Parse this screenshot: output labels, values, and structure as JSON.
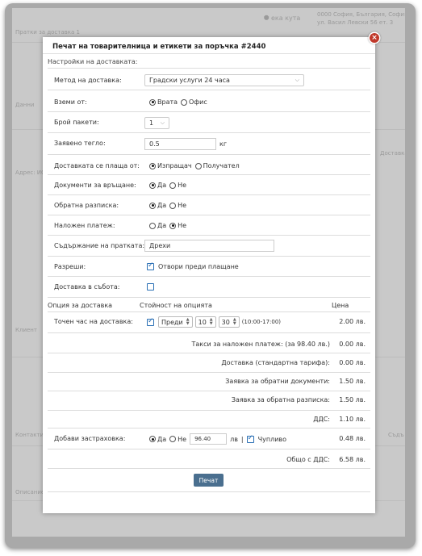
{
  "background": {
    "hint_top": "Пратки за доставка 1",
    "store": "⯃ ека кута",
    "addr1": "0000 София, България, София",
    "addr2": "ул. Васил Левски 56 ет. 3",
    "side1": "Данни",
    "side2": "Адрес: ИО",
    "side3": "Клиент",
    "side4": "Контакти",
    "side5": "Описание",
    "right1": "Доставка",
    "right2": "Съдъ"
  },
  "modal": {
    "title": "Печат на товарителница и етикети за поръчка #2440",
    "close": "×",
    "section": "Настройки на доставката:"
  },
  "fields": {
    "method": {
      "label": "Метод на доставка:",
      "value": "Градски услуги 24 часа"
    },
    "pickup": {
      "label": "Вземи от:",
      "opt1": "Врата",
      "opt2": "Офис"
    },
    "packages": {
      "label": "Брой пакети:",
      "value": "1"
    },
    "weight": {
      "label": "Заявено тегло:",
      "value": "0.5",
      "unit": "кг"
    },
    "payer": {
      "label": "Доставката се плаща от:",
      "opt1": "Изпращач",
      "opt2": "Получател"
    },
    "return_docs": {
      "label": "Документи за връщане:",
      "opt1": "Да",
      "opt2": "Не"
    },
    "return_receipt": {
      "label": "Обратна разписка:",
      "opt1": "Да",
      "opt2": "Не"
    },
    "cod": {
      "label": "Наложен платеж:",
      "opt1": "Да",
      "opt2": "Не"
    },
    "contents": {
      "label": "Съдържание на пратката:",
      "value": "Дрехи"
    },
    "allow": {
      "label": "Разреши:",
      "option": "Отвори преди плащане"
    },
    "saturday": {
      "label": "Доставка в събота:"
    }
  },
  "table": {
    "h_option": "Опция за доставка",
    "h_value": "Стойност на опцията",
    "h_price": "Цена",
    "exact_time": {
      "label": "Точен час на доставка:",
      "mode": "Преди",
      "hour": "10",
      "minute": "30",
      "range": "(10:00-17:00)",
      "price": "2.00 лв."
    },
    "fees": [
      {
        "label": "Такси за наложен платеж: (за 98.40 лв.)",
        "price": "0.00 лв."
      },
      {
        "label": "Доставка (стандартна тарифа):",
        "price": "0.00 лв."
      },
      {
        "label": "Заявка за обратни документи:",
        "price": "1.50 лв."
      },
      {
        "label": "Заявка за обратна разписка:",
        "price": "1.50 лв."
      },
      {
        "label": "ДДС:",
        "price": "1.10 лв."
      }
    ],
    "insurance": {
      "label": "Добави застраховка:",
      "opt1": "Да",
      "opt2": "Не",
      "amount": "96.40",
      "currency": "лв",
      "sep": "|",
      "fragile": "Чупливо",
      "price": "0.48 лв."
    },
    "total": {
      "label": "Общо с ДДС:",
      "price": "6.58 лв."
    }
  },
  "print_label": "Печат"
}
